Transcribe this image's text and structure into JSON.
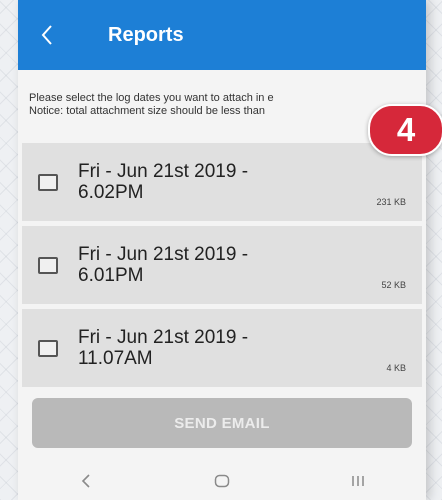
{
  "appbar": {
    "title": "Reports",
    "back_icon": "chevron-left-icon"
  },
  "notice": {
    "line1": "Please select the log dates you want to attach in e",
    "line2": "Notice: total attachment size should be less than"
  },
  "badge": {
    "text": "4",
    "color": "#d6283a"
  },
  "logs": [
    {
      "line1": "Fri - Jun 21st 2019 -",
      "line2": "6.02PM",
      "size": "231 KB",
      "checked": false
    },
    {
      "line1": "Fri - Jun 21st 2019 -",
      "line2": "6.01PM",
      "size": "52 KB",
      "checked": false
    },
    {
      "line1": "Fri - Jun 21st 2019 -",
      "line2": "11.07AM",
      "size": "4 KB",
      "checked": false
    }
  ],
  "send_button": {
    "label": "SEND EMAIL"
  },
  "navbar": {
    "back_icon": "nav-back-icon",
    "home_icon": "nav-home-icon",
    "recents_icon": "nav-recents-icon"
  },
  "colors": {
    "accent": "#1d7fd6",
    "badge": "#d6283a",
    "button_disabled": "#b9b9b9"
  }
}
